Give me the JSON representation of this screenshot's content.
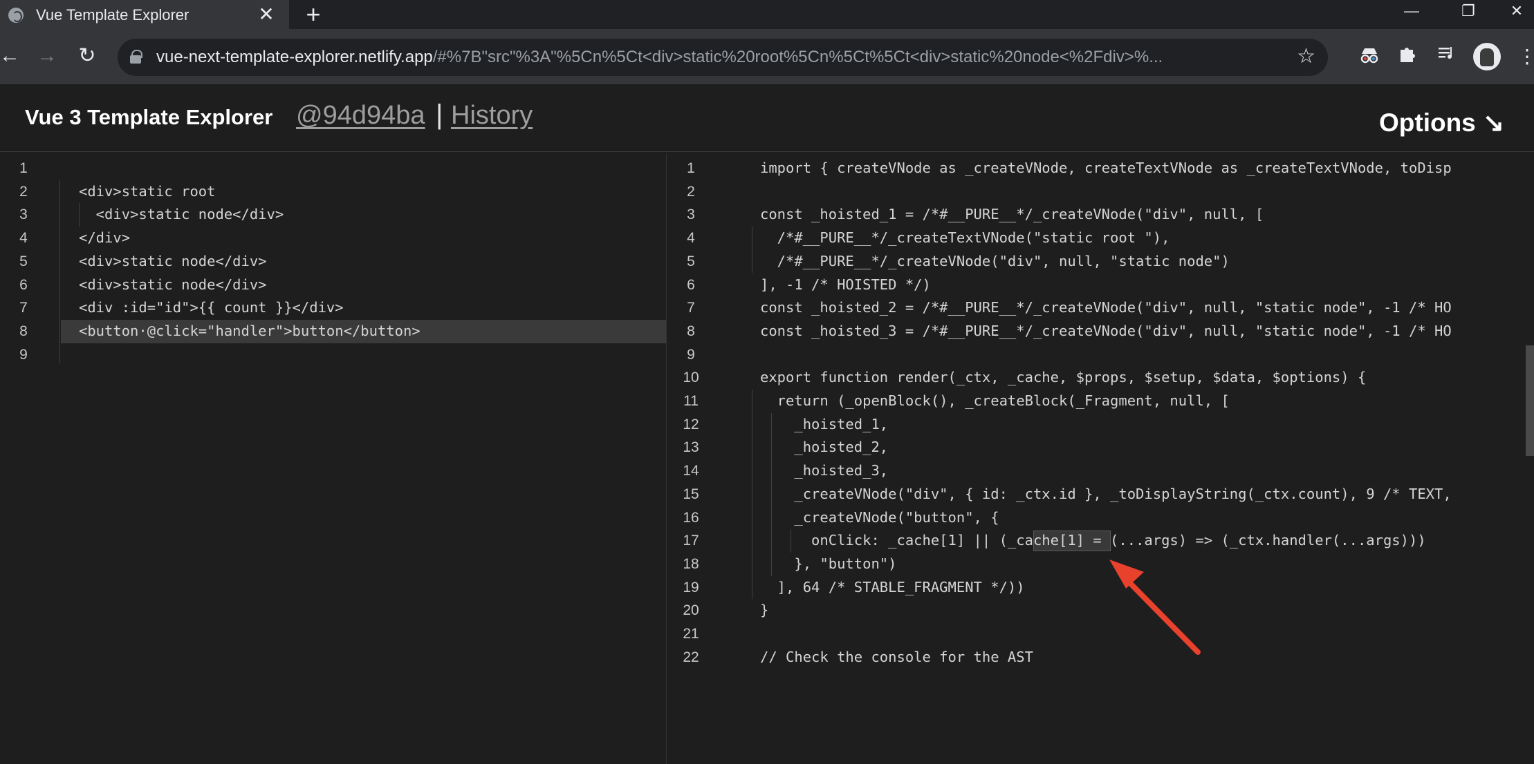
{
  "browser": {
    "tab_title": "Vue Template Explorer",
    "tab_close": "✕",
    "new_tab": "+",
    "url_host": "vue-next-template-explorer.netlify.app",
    "url_path": "/#%7B\"src\"%3A\"%5Cn%5Ct<div>static%20root%5Cn%5Ct%5Ct<div>static%20node<%2Fdiv>%...",
    "back_icon": "←",
    "forward_icon": "→",
    "reload_icon": "↻",
    "star_icon": "☆",
    "minimize_icon": "—",
    "restore_icon": "❐",
    "close_icon": "✕",
    "extensions": [
      "spy-icon",
      "puzzle-icon",
      "media-queue-icon"
    ],
    "menu_icon": "⋮"
  },
  "header": {
    "title": "Vue 3 Template Explorer",
    "commit": "@94d94ba",
    "separator": "|",
    "history": "History",
    "options": "Options ↘"
  },
  "template_editor": {
    "lines": [
      {
        "n": "1",
        "code": ""
      },
      {
        "n": "2",
        "code": "<div>static root"
      },
      {
        "n": "3",
        "code": "  <div>static node</div>"
      },
      {
        "n": "4",
        "code": "</div>"
      },
      {
        "n": "5",
        "code": "<div>static node</div>"
      },
      {
        "n": "6",
        "code": "<div>static node</div>"
      },
      {
        "n": "7",
        "code": "<div :id=\"id\">{{ count }}</div>"
      },
      {
        "n": "8",
        "code": "<button·@click=\"handler\">button</button>"
      },
      {
        "n": "9",
        "code": ""
      }
    ]
  },
  "output_editor": {
    "lines": [
      {
        "n": "1",
        "code": "import { createVNode as _createVNode, createTextVNode as _createTextVNode, toDisp"
      },
      {
        "n": "2",
        "code": ""
      },
      {
        "n": "3",
        "code": "const _hoisted_1 = /*#__PURE__*/_createVNode(\"div\", null, ["
      },
      {
        "n": "4",
        "code": "  /*#__PURE__*/_createTextVNode(\"static root \"),"
      },
      {
        "n": "5",
        "code": "  /*#__PURE__*/_createVNode(\"div\", null, \"static node\")"
      },
      {
        "n": "6",
        "code": "], -1 /* HOISTED */)"
      },
      {
        "n": "7",
        "code": "const _hoisted_2 = /*#__PURE__*/_createVNode(\"div\", null, \"static node\", -1 /* HO"
      },
      {
        "n": "8",
        "code": "const _hoisted_3 = /*#__PURE__*/_createVNode(\"div\", null, \"static node\", -1 /* HO"
      },
      {
        "n": "9",
        "code": ""
      },
      {
        "n": "10",
        "code": "export function render(_ctx, _cache, $props, $setup, $data, $options) {"
      },
      {
        "n": "11",
        "code": "  return (_openBlock(), _createBlock(_Fragment, null, ["
      },
      {
        "n": "12",
        "code": "    _hoisted_1,"
      },
      {
        "n": "13",
        "code": "    _hoisted_2,"
      },
      {
        "n": "14",
        "code": "    _hoisted_3,"
      },
      {
        "n": "15",
        "code": "    _createVNode(\"div\", { id: _ctx.id }, _toDisplayString(_ctx.count), 9 /* TEXT,"
      },
      {
        "n": "16",
        "code": "    _createVNode(\"button\", {"
      },
      {
        "n": "17",
        "code": "      onClick: _cache[1] || (_cache[1] = (...args) => (_ctx.handler(...args)))"
      },
      {
        "n": "18",
        "code": "    }, \"button\")"
      },
      {
        "n": "19",
        "code": "  ], 64 /* STABLE_FRAGMENT */))"
      },
      {
        "n": "20",
        "code": "}"
      },
      {
        "n": "21",
        "code": ""
      },
      {
        "n": "22",
        "code": "// Check the console for the AST"
      }
    ]
  },
  "colors": {
    "editor_bg": "#1e1e1e",
    "line_highlight": "#3a3a3a",
    "annotation_arrow": "#e8412c"
  }
}
